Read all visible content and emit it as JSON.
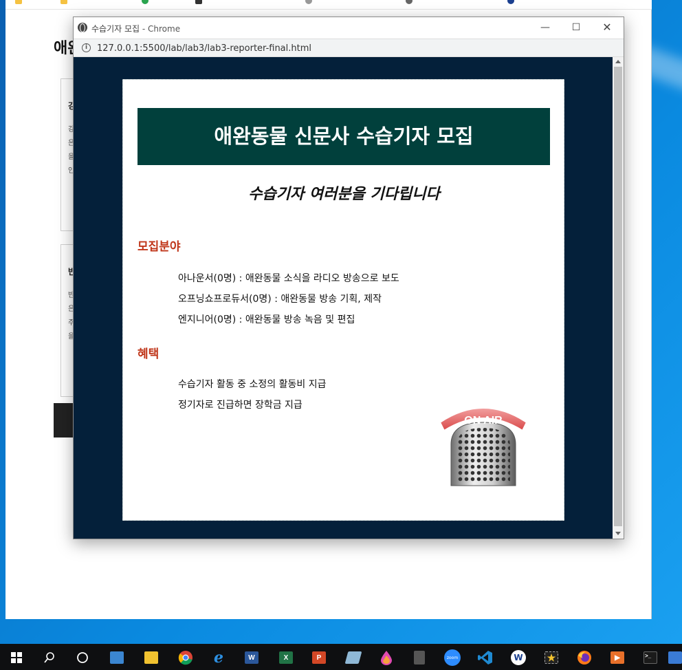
{
  "window": {
    "title_korean": "수습기자 모집",
    "title_app": " - Chrome",
    "minimize_glyph": "—",
    "maximize_glyph": "☐",
    "close_glyph": "✕"
  },
  "address_bar": {
    "info_glyph": "i",
    "url": "127.0.0.1:5500/lab/lab3/lab3-reporter-final.html"
  },
  "page": {
    "banner": "애완동물 신문사 수습기자 모집",
    "subtitle": "수습기자 여러분을 기다립니다",
    "sections": {
      "fields": {
        "heading": "모집분야",
        "items": [
          "아나운서(0명) : 애완동물 소식을 라디오 방송으로 보도",
          "오프닝쇼프로듀서(0명) : 애완동물 방송 기획, 제작",
          "엔지니어(0명) : 애완동물 방송 녹음 및 편집"
        ]
      },
      "benefits": {
        "heading": "혜택",
        "items": [
          "수습기자 활동 중 소정의 활동비 지급",
          "정기자로 진급하면 장학금 지급"
        ]
      }
    },
    "image_label": "ON AIR"
  },
  "background_page": {
    "heading": "애완",
    "card1_title": "강",
    "card1_lines": [
      "강",
      "은",
      "을",
      "인"
    ],
    "card2_title": "반",
    "card2_lines": [
      "반",
      "은",
      "주",
      "을"
    ]
  },
  "colors": {
    "viewport_bg": "#04203a",
    "banner_bg": "#01403c",
    "section_heading": "#c0361a"
  },
  "taskbar": {
    "icons": [
      "windows-start-icon",
      "search-icon",
      "task-view-icon",
      "contacts-icon",
      "file-explorer-icon",
      "chrome-icon",
      "edge-icon",
      "word-icon",
      "excel-icon",
      "powerpoint-icon",
      "notepad-icon",
      "paint-icon",
      "calculator-icon",
      "zoom-icon",
      "vscode-icon",
      "app-w-icon",
      "photo-star-icon",
      "firefox-icon",
      "media-player-icon",
      "terminal-icon",
      "app-partial-icon"
    ],
    "word_label": "W",
    "excel_label": "X",
    "ppt_label": "P",
    "zoom_label": "zoom"
  }
}
